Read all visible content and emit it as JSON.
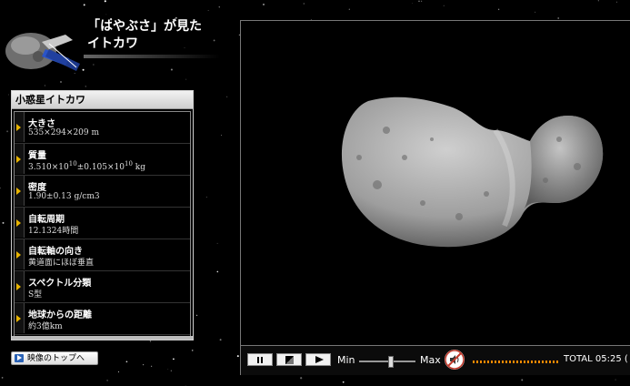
{
  "header": {
    "title_line1": "「はやぶさ」が見た",
    "title_line2": "イトカワ"
  },
  "panel": {
    "title": "小惑星イトカワ",
    "items": [
      {
        "label": "大きさ",
        "value": "535×294×209 m"
      },
      {
        "label": "質量",
        "value_html": "3.510×10<sup>10</sup>±0.105×10<sup>10</sup> kg",
        "value": "3.510×1010±0.105×1010 kg"
      },
      {
        "label": "密度",
        "value": "1.90±0.13 g/cm3"
      },
      {
        "label": "自転周期",
        "value": "12.1324時間"
      },
      {
        "label": "自転軸の向き",
        "value": "黄道面にほぼ垂直"
      },
      {
        "label": "スペクトル分類",
        "value": "S型"
      },
      {
        "label": "地球からの距離",
        "value": "約3億km"
      }
    ]
  },
  "top_button": {
    "label": "映像のトップへ"
  },
  "controls": {
    "min_label": "Min",
    "max_label": "Max",
    "volume_level": 0.55,
    "total_label": "TOTAL 05:25 (",
    "accent": "#ff8a00"
  },
  "icons": {
    "pause": "pause-icon",
    "stop": "stop-icon",
    "play": "play-icon",
    "mute": "mute-icon",
    "panel_marker": "arrow-right-icon"
  }
}
